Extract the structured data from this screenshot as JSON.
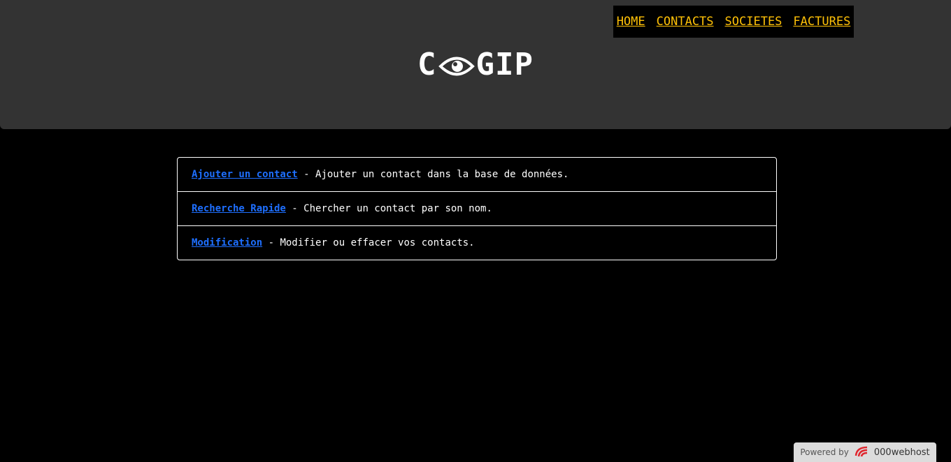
{
  "nav": {
    "items": [
      {
        "label": "HOME"
      },
      {
        "label": "CONTACTS"
      },
      {
        "label": "SOCIETES"
      },
      {
        "label": "FACTURES"
      }
    ]
  },
  "logo": {
    "left": "C",
    "right": "GIP"
  },
  "links": [
    {
      "link": "Ajouter un contact",
      "desc": "Ajouter un contact dans la base de données."
    },
    {
      "link": "Recherche Rapide",
      "desc": "Chercher un contact par son nom."
    },
    {
      "link": "Modification",
      "desc": "Modifier ou effacer vos contacts."
    }
  ],
  "separator": " - ",
  "footer": {
    "powered_by": "Powered by",
    "brand": "000webhost"
  },
  "colors": {
    "nav_link": "#ffc107",
    "content_link": "#1e6fff",
    "header_bg": "#333333"
  }
}
